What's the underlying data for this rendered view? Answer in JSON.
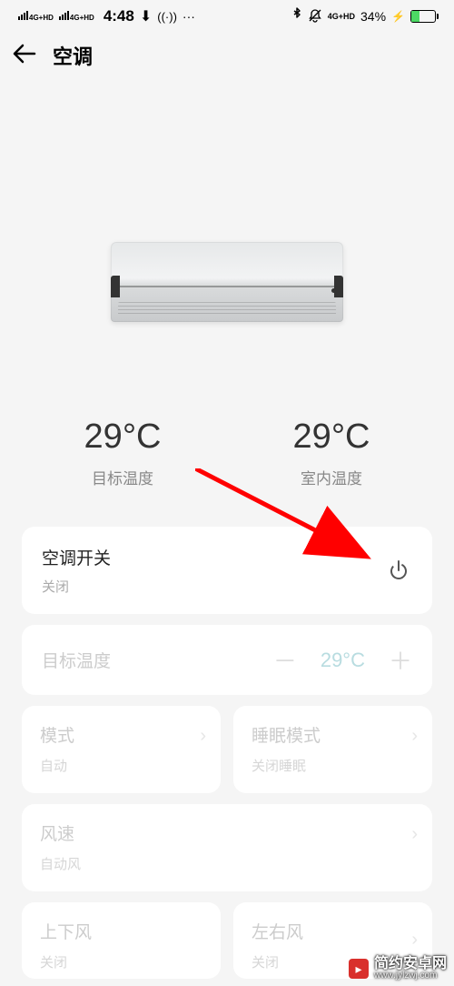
{
  "status": {
    "signal_label": "4G+HD",
    "time": "4:48",
    "battery_pct": "34%"
  },
  "header": {
    "title": "空调"
  },
  "temps": {
    "target_value": "29°C",
    "target_label": "目标温度",
    "indoor_value": "29°C",
    "indoor_label": "室内温度"
  },
  "power": {
    "title": "空调开关",
    "status": "关闭"
  },
  "target_temp": {
    "label": "目标温度",
    "value": "29°C"
  },
  "cards": {
    "mode": {
      "title": "模式",
      "sub": "自动"
    },
    "sleep": {
      "title": "睡眠模式",
      "sub": "关闭睡眠"
    },
    "wind": {
      "title": "风速",
      "sub": "自动风"
    },
    "updown": {
      "title": "上下风",
      "sub": "关闭"
    },
    "leftright": {
      "title": "左右风",
      "sub": "关闭"
    }
  },
  "watermark": {
    "zh": "简约安卓网",
    "url": "www.jylzwj.com"
  }
}
